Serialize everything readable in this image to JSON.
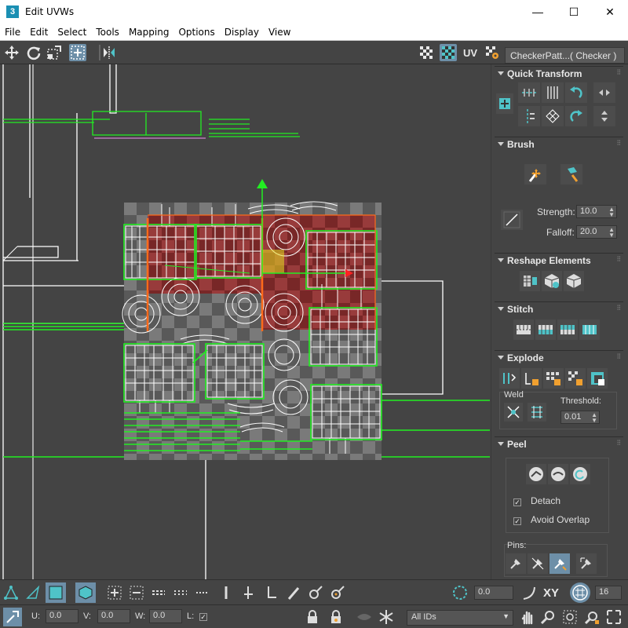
{
  "window": {
    "app_icon_text": "3",
    "title": "Edit UVWs",
    "minimize_glyph": "—",
    "maximize_glyph": "☐",
    "close_glyph": "✕"
  },
  "menu": [
    "File",
    "Edit",
    "Select",
    "Tools",
    "Mapping",
    "Options",
    "Display",
    "View"
  ],
  "toolbar": {
    "uv_label": "UV",
    "texture_dropdown": "CheckerPatt...( Checker )"
  },
  "panel": {
    "quick_transform": {
      "title": "Quick Transform"
    },
    "brush": {
      "title": "Brush",
      "strength_label": "Strength:",
      "strength_value": "10.0",
      "falloff_label": "Falloff:",
      "falloff_value": "20.0"
    },
    "reshape": {
      "title": "Reshape Elements"
    },
    "stitch": {
      "title": "Stitch"
    },
    "explode": {
      "title": "Explode",
      "weld_label": "Weld",
      "threshold_label": "Threshold:",
      "threshold_value": "0.01"
    },
    "peel": {
      "title": "Peel",
      "detach_label": "Detach",
      "detach_checked": true,
      "avoid_overlap_label": "Avoid Overlap",
      "avoid_overlap_checked": true,
      "pins_label": "Pins:"
    }
  },
  "bottom": {
    "rotate_value": "0.0",
    "xy_label": "XY",
    "grid_value": "16",
    "u_label": "U:",
    "u_value": "0.0",
    "v_label": "V:",
    "v_value": "0.0",
    "w_label": "W:",
    "w_value": "0.0",
    "l_label": "L:",
    "ids_dropdown": "All IDs"
  },
  "colors": {
    "accent": "#4fc3c8",
    "select_highlight": "#6d8fa8",
    "wire_green": "#22dd22",
    "selection_red": "#8a2a2a"
  }
}
